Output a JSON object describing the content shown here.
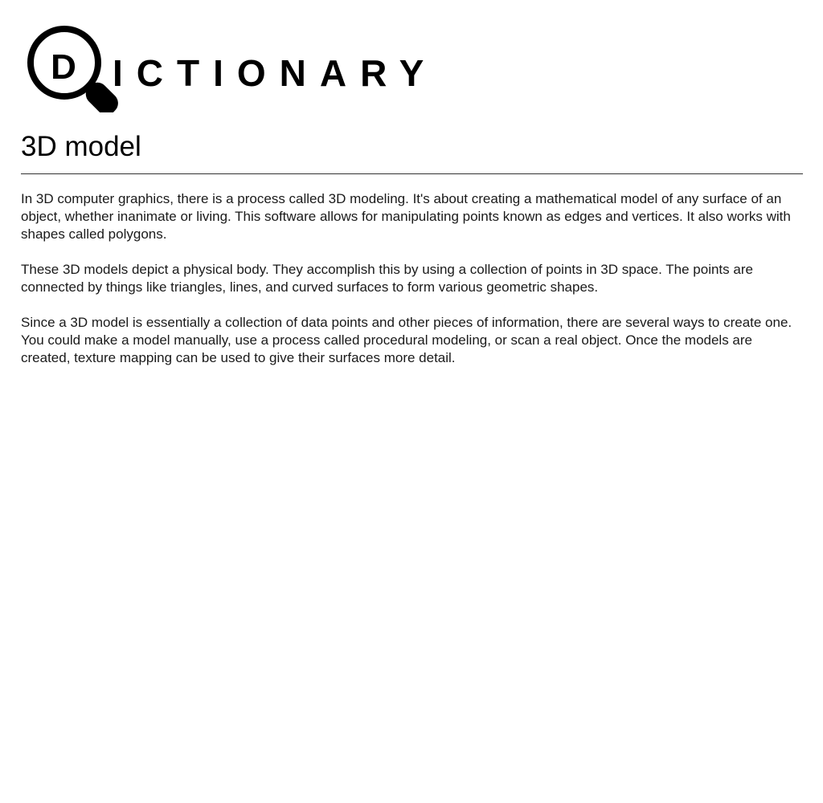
{
  "header": {
    "logo_letter": "D",
    "logo_rest": "ICTIONARY"
  },
  "article": {
    "title": "3D model",
    "paragraphs": [
      "In 3D computer graphics, there is a process called 3D modeling. It's about creating a mathematical model of any surface of an object, whether inanimate or living. This software allows for manipulating points known as edges and vertices. It also works with shapes called polygons.",
      "These 3D models depict a physical body. They accomplish this by using a collection of points in 3D space. The points are connected by things like triangles, lines, and curved surfaces to form various geometric shapes.",
      "Since a 3D model is essentially a collection of data points and other pieces of information, there are several ways to create one. You could make a model manually, use a process called procedural modeling, or scan a real object. Once the models are created, texture mapping can be used to give their surfaces more detail."
    ]
  },
  "colors": {
    "text": "#1a1a1a",
    "logo": "#000000",
    "background": "#ffffff"
  }
}
